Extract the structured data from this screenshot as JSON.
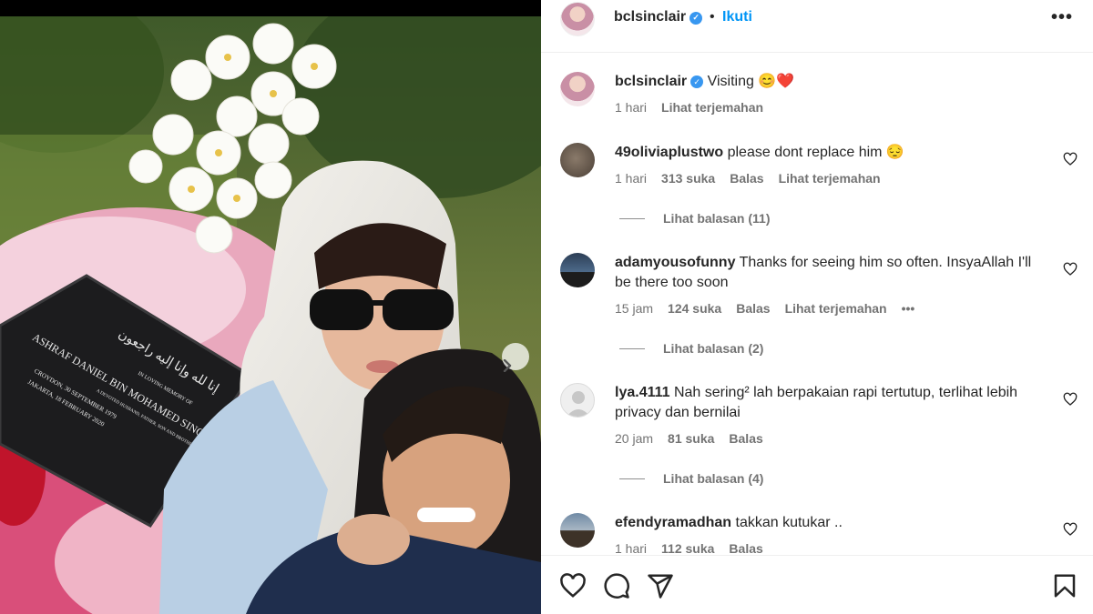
{
  "post": {
    "username": "bclsinclair",
    "separator": "•",
    "follow_label": "Ikuti",
    "more_label": "•••"
  },
  "caption": {
    "username": "bclsinclair",
    "text": "Visiting 😊❤️",
    "time": "1 hari",
    "translate": "Lihat terjemahan"
  },
  "comments": [
    {
      "username": "49oliviaplustwo",
      "text": "please dont replace him 😔",
      "time": "1 hari",
      "likes": "313 suka",
      "reply": "Balas",
      "translate": "Lihat terjemahan",
      "view_replies": "Lihat balasan (11)"
    },
    {
      "username": "adamyousofunny",
      "text": "Thanks for seeing him so often. InsyaAllah I'll be there too soon",
      "time": "15 jam",
      "likes": "124 suka",
      "reply": "Balas",
      "translate": "Lihat terjemahan",
      "more": "•••",
      "view_replies": "Lihat balasan (2)"
    },
    {
      "username": "lya.4111",
      "text": "Nah sering² lah berpakaian rapi tertutup, terlihat lebih privacy dan bernilai",
      "time": "20 jam",
      "likes": "81 suka",
      "reply": "Balas",
      "view_replies": "Lihat balasan (4)"
    },
    {
      "username": "efendyramadhan",
      "text": "takkan kutukar ..",
      "time": "1 hari",
      "likes": "112 suka",
      "reply": "Balas"
    }
  ],
  "photo": {
    "plaque_name": "ASHRAF DANIEL BIN MOHAMED SINCLAIR",
    "plaque_memory": "IN LOVING MEMORY OF",
    "plaque_sub": "A DEVOTED HUSBAND, FATHER, SON AND BROTHER",
    "plaque_born": "CROYDON, 30 SEPTEMBER 1979",
    "plaque_died": "JAKARTA, 18 FEBRUARY 2020",
    "plaque_arabic": "إنا لله وإنا إليه راجعون"
  },
  "colors": {
    "link_blue": "#0095f6",
    "verified_blue": "#3897f0",
    "muted_text": "#737373"
  },
  "icons": [
    "chevron-right-icon",
    "verified-icon",
    "more-icon",
    "heart-icon",
    "comment-icon",
    "share-icon",
    "bookmark-icon"
  ]
}
